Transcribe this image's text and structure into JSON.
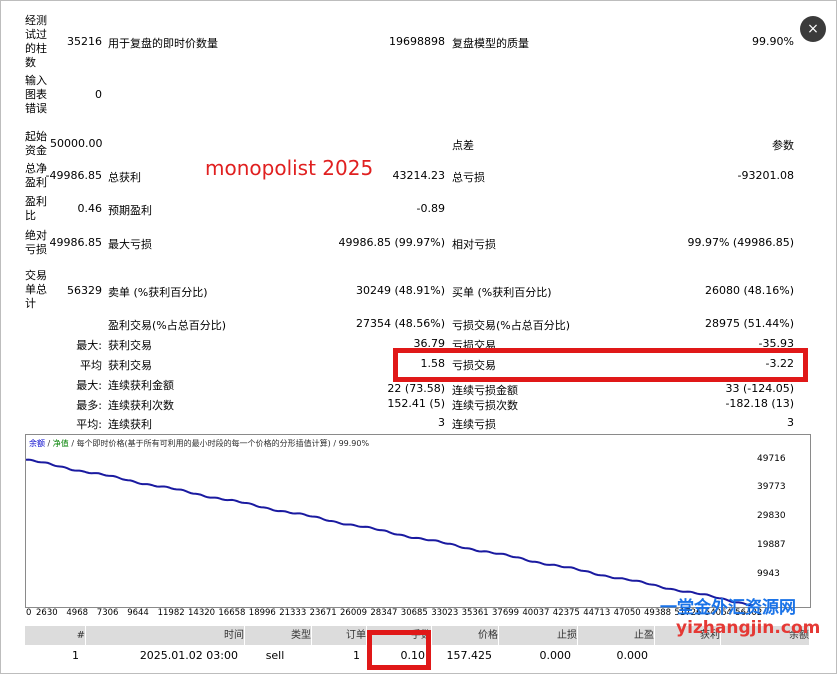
{
  "close_icon": "×",
  "watermark": "monopolist 2025",
  "stats": {
    "r1": {
      "label": "经测试过的柱数",
      "v1": "35216",
      "l2": "用于复盘的即时价数量",
      "v2": "19698898",
      "l3": "复盘模型的质量",
      "v3": "99.90%"
    },
    "r2": {
      "label": "输入图表错误",
      "v1": "0"
    },
    "r3": {
      "label": "起始资金",
      "v1": "50000.00",
      "l3": "点差",
      "v3": "参数"
    },
    "r4": {
      "label": "总净盈利",
      "v1": "-49986.85",
      "l2": "总获利",
      "v2": "43214.23",
      "l3": "总亏损",
      "v3": "-93201.08"
    },
    "r5": {
      "label": "盈利比",
      "v1": "0.46",
      "l2": "预期盈利",
      "v2": "-0.89"
    },
    "r6": {
      "label": "绝对亏损",
      "v1": "49986.85",
      "l2": "最大亏损",
      "v2": "49986.85 (99.97%)",
      "l3": "相对亏损",
      "v3": "99.97% (49986.85)"
    },
    "r7": {
      "label": "交易单总计",
      "v1": "56329",
      "l2": "卖单 (%获利百分比)",
      "v2": "30249 (48.91%)",
      "l3": "买单 (%获利百分比)",
      "v3": "26080 (48.16%)"
    },
    "r8": {
      "l2": "盈利交易(%占总百分比)",
      "v2": "27354 (48.56%)",
      "l3": "亏损交易(%占总百分比)",
      "v3": "28975 (51.44%)"
    },
    "r9": {
      "pre": "最大:",
      "l2": "获利交易",
      "v2": "36.79",
      "l3": "亏损交易",
      "v3": "-35.93"
    },
    "r10": {
      "pre": "平均",
      "l2": "获利交易",
      "v2": "1.58",
      "l3": "亏损交易",
      "v3": "-3.22"
    },
    "r11": {
      "pre": "最大:",
      "l2": "连续获利金额",
      "v2": "22 (73.58)",
      "l3": "连续亏损金额",
      "v3": "33 (-124.05)"
    },
    "r12": {
      "pre": "最多:",
      "l2": "连续获利次数",
      "v2": "152.41 (5)",
      "l3": "连续亏损次数",
      "v3": "-182.18 (13)"
    },
    "r13": {
      "pre": "平均:",
      "l2": "连续获利",
      "v2": "3",
      "l3": "连续亏损",
      "v3": "3"
    }
  },
  "chart": {
    "title_part1": "余额",
    "sep1": " / ",
    "title_part2": "净值",
    "title_rest": " / 每个即时价格(基于所有可利用的最小时段的每一个价格的分形插值计算) / 99.90%",
    "line_color": "#1a1aa0",
    "y_ticks": [
      "49716",
      "39773",
      "29830",
      "19887",
      "9943"
    ],
    "x_ticks": [
      "0",
      "2630",
      "4968",
      "7306",
      "9644",
      "11982",
      "14320",
      "16658",
      "18996",
      "21333",
      "23671",
      "26009",
      "28347",
      "30685",
      "33023",
      "35361",
      "37699",
      "40037",
      "42375",
      "44713",
      "47050",
      "49388",
      "51726",
      "54064",
      "56402"
    ]
  },
  "chart_data": {
    "type": "line",
    "series": [
      {
        "name": "余额",
        "x": [
          0,
          56329
        ],
        "y": [
          50000,
          13
        ]
      }
    ],
    "ylim": [
      0,
      53000
    ],
    "xlim": [
      0,
      56402
    ],
    "y_tick_values": [
      49716,
      39773,
      29830,
      19887,
      9943
    ]
  },
  "table": {
    "headers": [
      "#",
      "时间",
      "类型",
      "订单",
      "手数",
      "价格",
      "止损",
      "止盈",
      "获利",
      "余额"
    ],
    "row": [
      "1",
      "2025.01.02 03:00",
      "sell",
      "1",
      "0.10",
      "157.425",
      "0.000",
      "0.000",
      "",
      ""
    ]
  },
  "site_watermark": {
    "cn": "一堂金外汇资源网",
    "url": "yizhangjin.com"
  }
}
